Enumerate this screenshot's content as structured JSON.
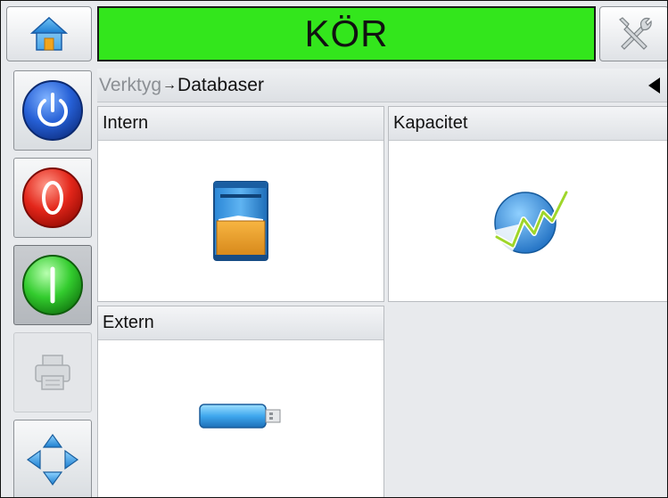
{
  "header": {
    "status_text": "KÖR",
    "status_color": "#33e61c",
    "home_icon": "home-icon",
    "tools_icon": "tools-icon"
  },
  "sidebar": {
    "items": [
      {
        "name": "power",
        "icon": "power-icon",
        "color": "#1f57c9"
      },
      {
        "name": "stop",
        "icon": "stop-icon",
        "color": "#e0261b"
      },
      {
        "name": "start",
        "icon": "start-icon",
        "color": "#2ecc2e",
        "state": "pressed"
      },
      {
        "name": "print",
        "icon": "printer-icon",
        "state": "disabled"
      },
      {
        "name": "navigate",
        "icon": "navigate-arrows-icon"
      }
    ]
  },
  "breadcrumb": {
    "parent": "Verktyg",
    "separator": "→",
    "current": "Databaser"
  },
  "tiles": [
    {
      "label": "Intern",
      "icon": "internal-database-icon"
    },
    {
      "label": "Kapacitet",
      "icon": "capacity-chart-icon"
    },
    {
      "label": "Extern",
      "icon": "usb-drive-icon"
    }
  ]
}
